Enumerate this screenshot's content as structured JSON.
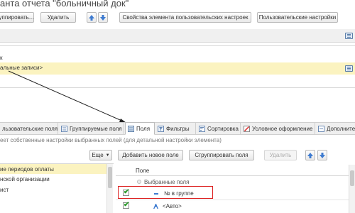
{
  "window": {
    "title": "анта отчета \"больничный док\""
  },
  "toolbar": {
    "group_button": "уппировать...",
    "delete_button": "Удалить",
    "element_props_button": "Свойства элемента пользовательских настроек",
    "user_settings_button": "Пользовательские настройки"
  },
  "structure": {
    "row1_label": "к",
    "row2_label": "альные записи>"
  },
  "tabs": [
    {
      "label": "льзовательские поля",
      "active": false,
      "icon": "user-fields-icon"
    },
    {
      "label": "Группируемые поля",
      "active": false,
      "icon": "grouped-fields-icon"
    },
    {
      "label": "Поля",
      "active": true,
      "icon": "fields-icon"
    },
    {
      "label": "Фильтры",
      "active": false,
      "icon": "filter-icon"
    },
    {
      "label": "Сортировка",
      "active": false,
      "icon": "sort-icon"
    },
    {
      "label": "Условное оформление",
      "active": false,
      "icon": "conditional-format-icon"
    },
    {
      "label": "Дополните",
      "active": false,
      "icon": "additional-icon"
    }
  ],
  "fields_panel": {
    "info_text": "еет собственные настройки выбранных полей (для детальной настройки элемента)",
    "more_button": "Еще",
    "add_field_button": "Добавить новое поле",
    "group_fields_button": "Сгруппировать поля",
    "delete_button": "Удалить",
    "column_header": "Поле",
    "available_fields": [
      {
        "label": "ие периодов оплаты",
        "highlighted": true
      },
      {
        "label": "нской организации",
        "highlighted": false
      },
      {
        "label": "ист",
        "highlighted": false
      }
    ],
    "selected_fields": [
      {
        "label": "Выбранные поля",
        "checked": null,
        "icon": "folder-icon"
      },
      {
        "label": "№ в группе",
        "checked": true,
        "icon": "minus-icon"
      },
      {
        "label": "<Авто>",
        "checked": true,
        "icon": "auto-icon"
      }
    ]
  },
  "colors": {
    "highlight": "#fbf3c0",
    "accent_blue": "#3e7bd0",
    "red_outline": "#dd2222",
    "check_green": "#2a9a2a"
  }
}
